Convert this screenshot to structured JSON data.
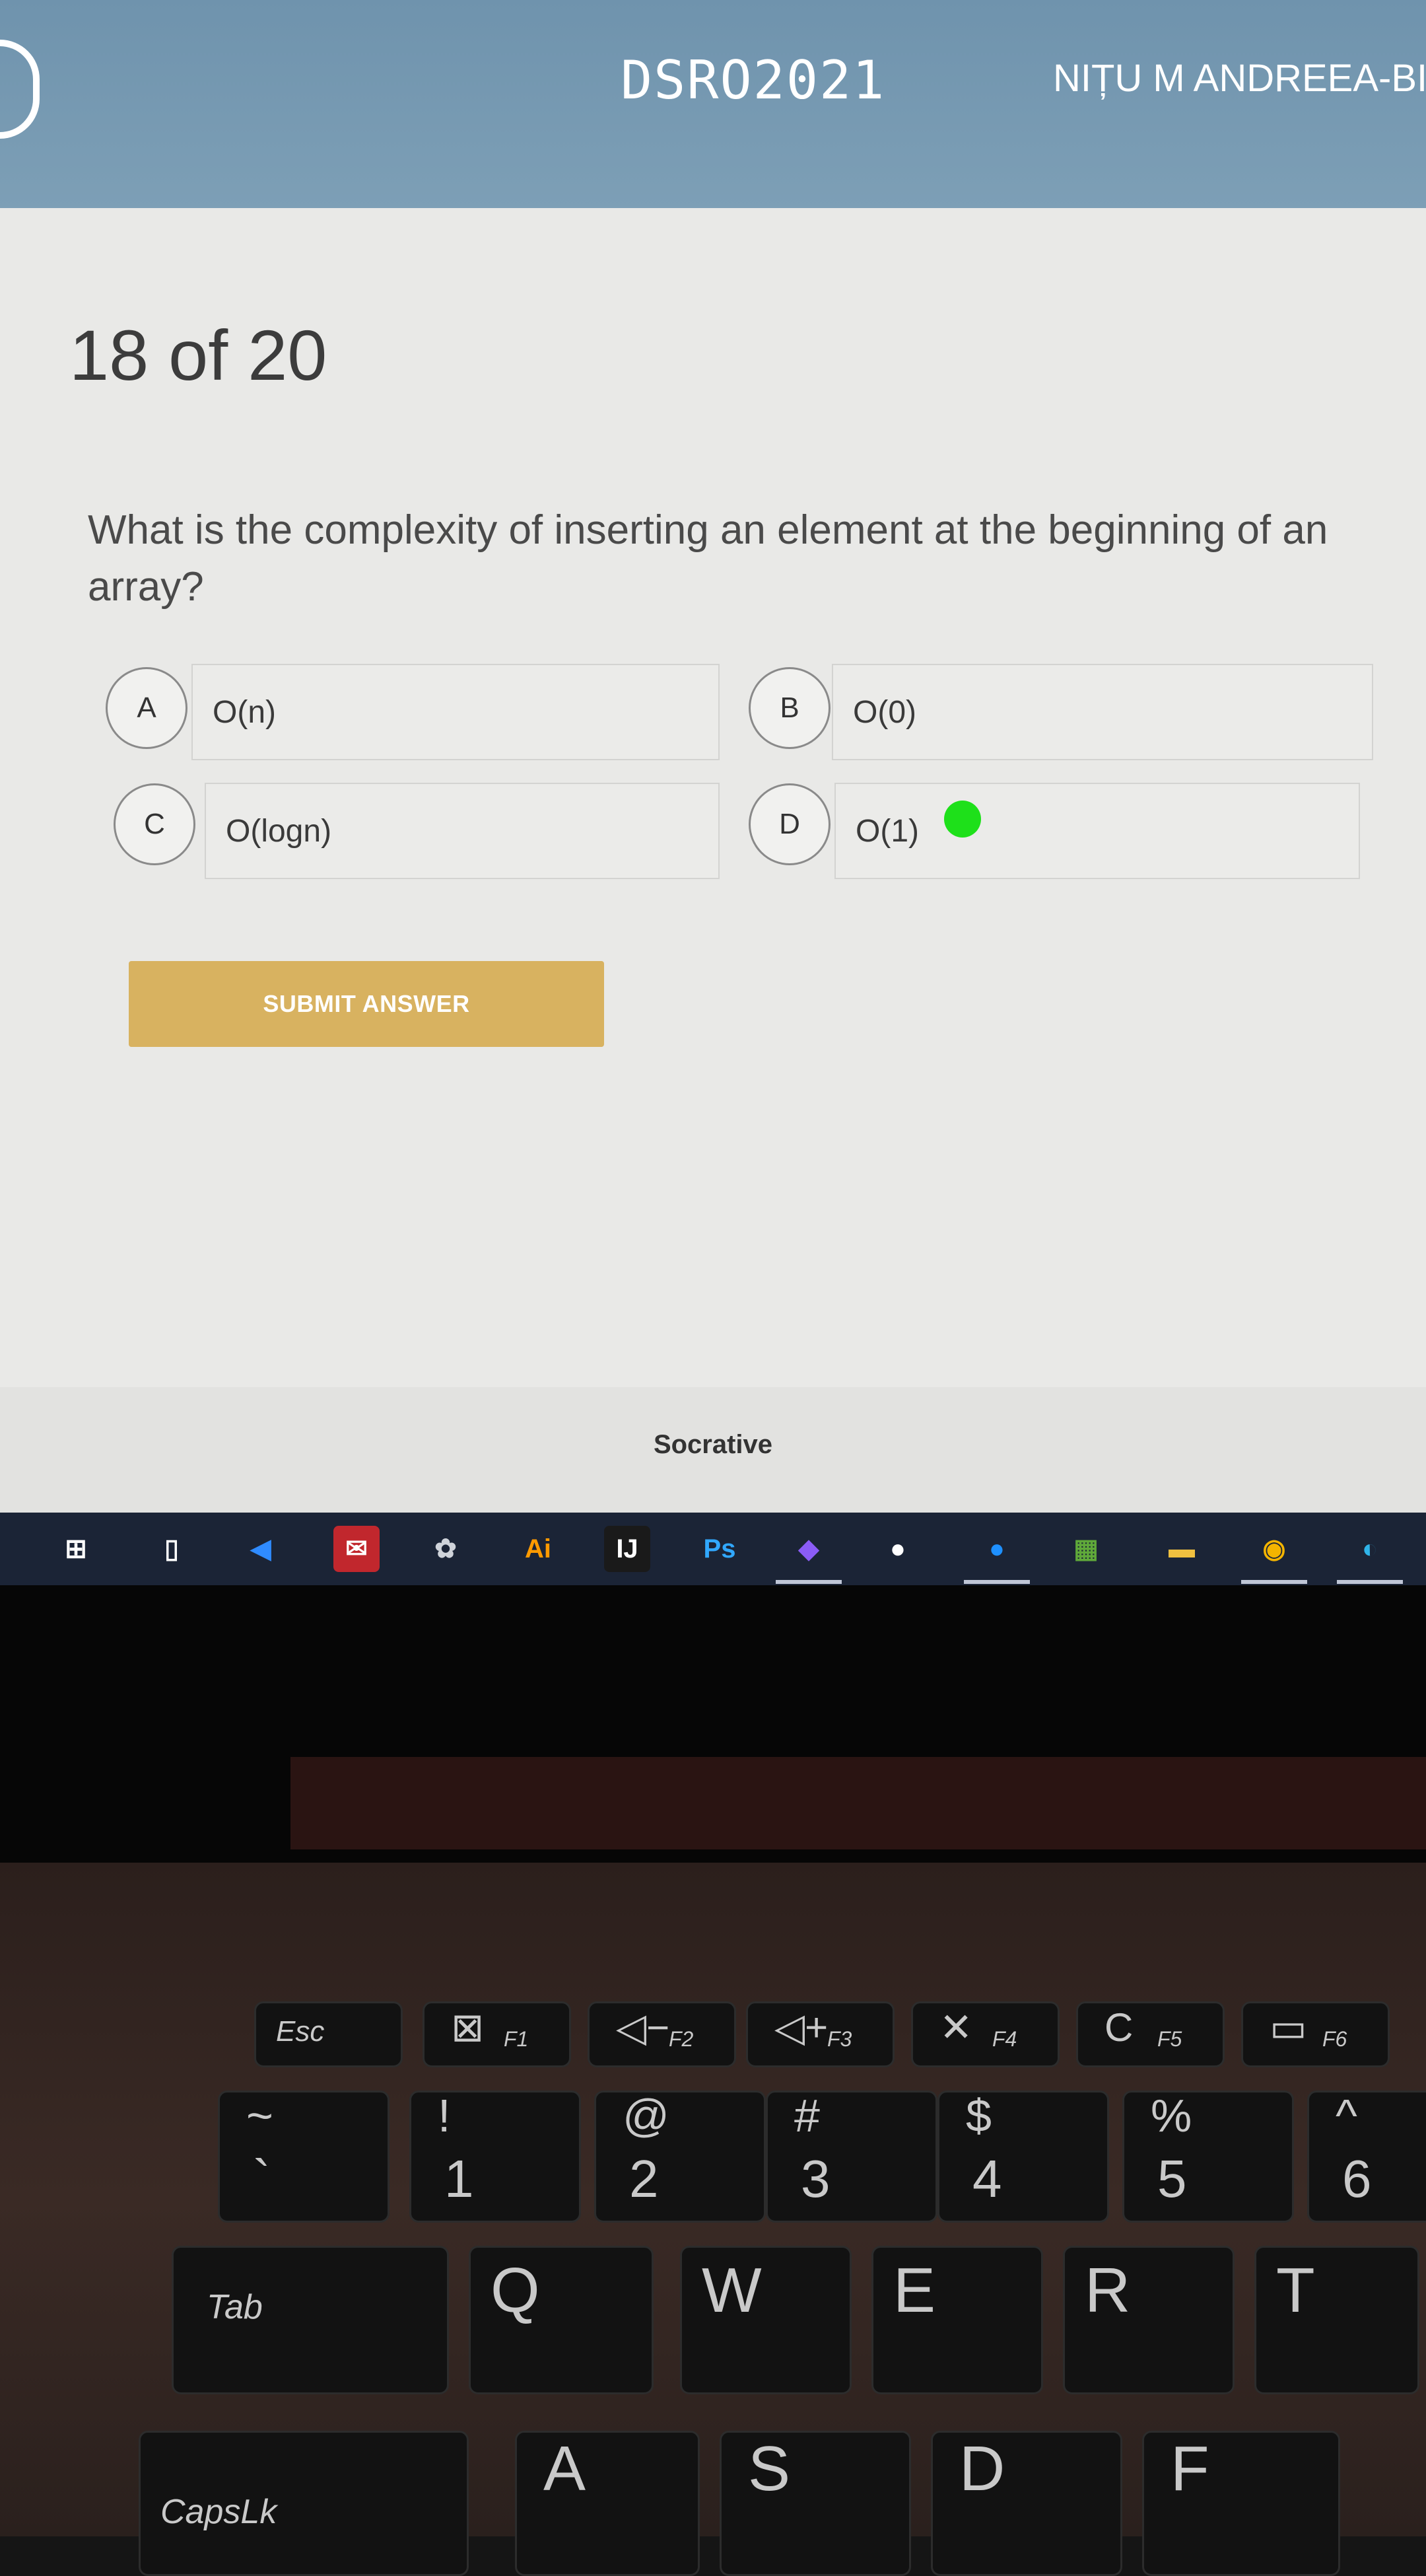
{
  "header": {
    "room_name": "DSRO2021",
    "student_name": "NIȚU M ANDREEA-BI"
  },
  "quiz": {
    "progress": "18 of 20",
    "question": "What is the complexity of inserting an element at the beginning of an array?",
    "choices": [
      {
        "letter": "A",
        "text": "O(n)"
      },
      {
        "letter": "B",
        "text": "O(0)"
      },
      {
        "letter": "C",
        "text": "O(logn)"
      },
      {
        "letter": "D",
        "text": "O(1)"
      }
    ],
    "submit_label": "SUBMIT ANSWER",
    "marker_color": "#1ee01a"
  },
  "footer": {
    "brand": "Socrative"
  },
  "taskbar": {
    "icons": [
      {
        "name": "windows-start-icon",
        "glyph": "⊞",
        "color": "#ffffff",
        "bg": "transparent"
      },
      {
        "name": "task-view-icon",
        "glyph": "▯",
        "color": "#ffffff",
        "bg": "transparent"
      },
      {
        "name": "vscode-icon",
        "glyph": "◀",
        "color": "#2f8bff",
        "bg": "transparent"
      },
      {
        "name": "mail-icon",
        "glyph": "✉",
        "color": "#ffffff",
        "bg": "#c1272d"
      },
      {
        "name": "app-icon",
        "glyph": "✿",
        "color": "#cfd3da",
        "bg": "transparent"
      },
      {
        "name": "illustrator-icon",
        "glyph": "Ai",
        "color": "#ff9a00",
        "bg": "transparent"
      },
      {
        "name": "intellij-icon",
        "glyph": "IJ",
        "color": "#ffffff",
        "bg": "#1a1a1a"
      },
      {
        "name": "photoshop-icon",
        "glyph": "Ps",
        "color": "#31a8ff",
        "bg": "transparent"
      },
      {
        "name": "visual-studio-icon",
        "glyph": "◆",
        "color": "#8b5cf6",
        "bg": "transparent"
      },
      {
        "name": "github-icon",
        "glyph": "●",
        "color": "#ffffff",
        "bg": "transparent"
      },
      {
        "name": "chat-icon",
        "glyph": "●",
        "color": "#1e90ff",
        "bg": "transparent"
      },
      {
        "name": "minecraft-icon",
        "glyph": "▦",
        "color": "#5fa83a",
        "bg": "transparent"
      },
      {
        "name": "file-explorer-icon",
        "glyph": "▬",
        "color": "#f0c040",
        "bg": "transparent"
      },
      {
        "name": "chrome-icon",
        "glyph": "◉",
        "color": "#f4b400",
        "bg": "transparent"
      },
      {
        "name": "edge-icon",
        "glyph": "◐",
        "color": "#2fb4e9",
        "bg": "transparent"
      }
    ]
  },
  "keyboard": {
    "row_fn": [
      {
        "main": "Esc"
      },
      {
        "icon": "⊠",
        "sub": "F1"
      },
      {
        "icon": "◁−",
        "sub": "F2"
      },
      {
        "icon": "◁+",
        "sub": "F3"
      },
      {
        "icon": "✕",
        "sub": "F4"
      },
      {
        "icon": "C",
        "sub": "F5"
      },
      {
        "icon": "▭",
        "sub": "F6"
      }
    ],
    "row_num": [
      {
        "top": "~",
        "bottom": "`"
      },
      {
        "top": "!",
        "bottom": "1"
      },
      {
        "top": "@",
        "bottom": "2"
      },
      {
        "top": "#",
        "bottom": "3"
      },
      {
        "top": "$",
        "bottom": "4"
      },
      {
        "top": "%",
        "bottom": "5"
      },
      {
        "top": "^",
        "bottom": "6"
      }
    ],
    "row_q": [
      "Tab",
      "Q",
      "W",
      "E",
      "R",
      "T"
    ],
    "row_a": [
      "CapsLk",
      "A",
      "S",
      "D",
      "F"
    ]
  }
}
